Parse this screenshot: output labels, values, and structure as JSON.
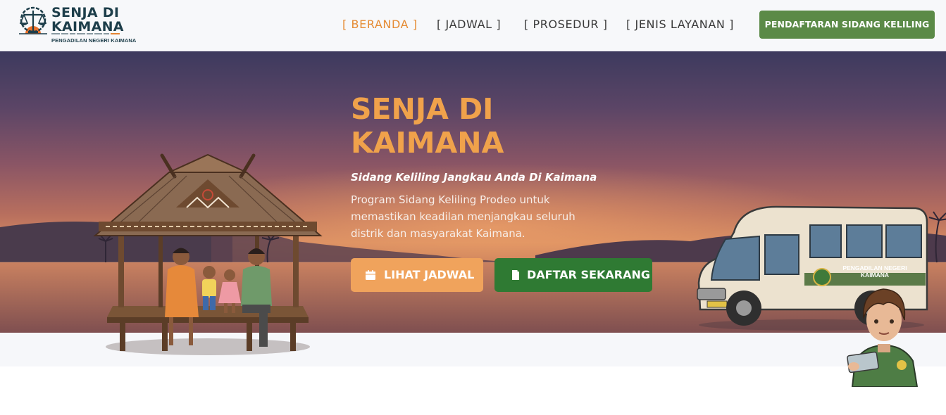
{
  "navbar": {
    "logo": {
      "title_line1": "SENJA DI",
      "title_line2": "KAIMANA",
      "subtitle": "PENGADILAN NEGERI KAIMANA",
      "emblem_icon": "scales-of-justice-icon"
    },
    "links": [
      {
        "label": "[ BERANDA ]",
        "active": true
      },
      {
        "label": "[ JADWAL ]",
        "active": false
      },
      {
        "label": "[ PROSEDUR ]",
        "active": false
      },
      {
        "label": "[ JENIS LAYANAN ]",
        "active": false
      }
    ],
    "cta_label": "PENDAFTARAN SIDANG KELILING"
  },
  "hero": {
    "title_line1": "SENJA DI",
    "title_line2": "KAIMANA",
    "subtitle": "Sidang Keliling Jangkau Anda Di Kaimana",
    "description": "Program Sidang Keliling Prodeo untuk memastikan keadilan menjangkau seluruh distrik dan masyarakat Kaimana.",
    "buttons": {
      "schedule": {
        "label": "LIHAT JADWAL",
        "icon": "calendar-icon"
      },
      "register": {
        "label": "DAFTAR SEKARANG",
        "icon": "document-icon"
      }
    },
    "van_label_line1": "PENGADILAN NEGERI",
    "van_label_line2": "KAIMANA"
  },
  "colors": {
    "accent_orange": "#e58b33",
    "cta_green": "#5b8a47",
    "button_orange": "#f0a35c",
    "button_green": "#2f7a33",
    "title_orange": "#f0a24b",
    "logo_navy": "#1d3e4a"
  }
}
